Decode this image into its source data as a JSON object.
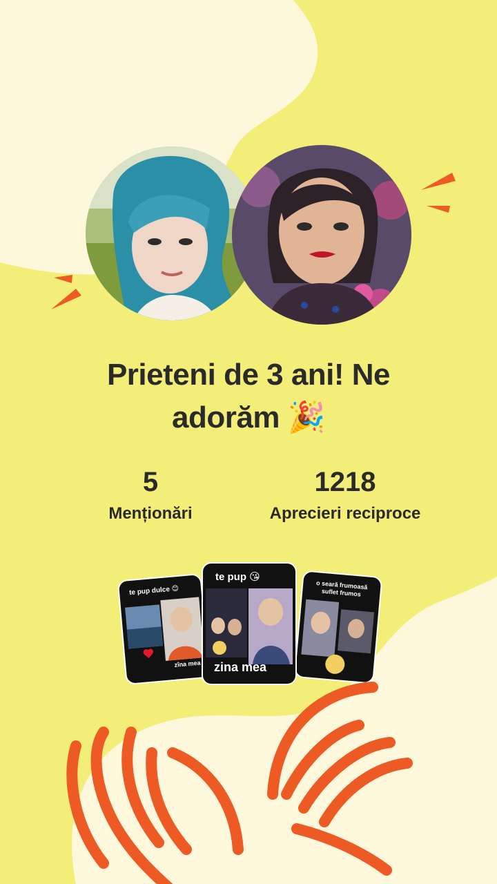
{
  "headline": {
    "line1": "Prieteni de 3 ani! Ne",
    "line2": "adorăm",
    "emoji": "🎉"
  },
  "stats": [
    {
      "value": "5",
      "label": "Menționări"
    },
    {
      "value": "1218",
      "label": "Aprecieri reciproce"
    }
  ],
  "thumbnails": [
    {
      "caption": "te pup dulce 😊",
      "subcaption": "zîna mea"
    },
    {
      "caption": "te pup 😘",
      "subcaption": "zina mea"
    },
    {
      "caption": "o seară frumoasă suflet frumos",
      "subcaption": ""
    }
  ],
  "colors": {
    "background_yellow": "#f3ee78",
    "cream_shape": "#fdf8dc",
    "accent_orange": "#ee5a24",
    "text": "#2a2a2a"
  }
}
